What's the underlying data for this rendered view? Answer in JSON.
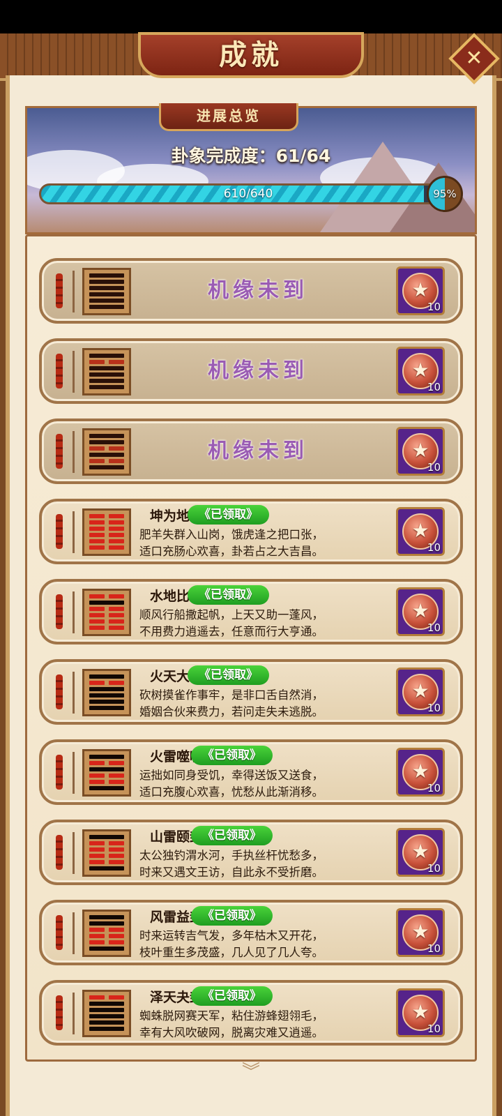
{
  "window": {
    "title": "成就",
    "close_glyph": "✕"
  },
  "overview": {
    "tab_label": "进展总览",
    "completion_text": "卦象完成度：61/64",
    "progress_text": "610/640",
    "progress_fraction": 0.953,
    "percent_text": "95%"
  },
  "locked_text": "机缘未到",
  "claimed_label": "《已领取》",
  "reward_count": "10",
  "items": [
    {
      "state": "locked",
      "lines": [
        1,
        1,
        1,
        1,
        1,
        1
      ]
    },
    {
      "state": "locked",
      "lines": [
        1,
        0,
        1,
        1,
        1,
        1
      ]
    },
    {
      "state": "locked",
      "lines": [
        1,
        1,
        0,
        1,
        0,
        1
      ]
    },
    {
      "state": "claimed",
      "name": "坤为地卦",
      "desc1": "肥羊失群入山岗，饿虎逢之把口张，",
      "desc2": "适口充肠心欢喜，卦若占之大吉昌。",
      "lines": [
        0,
        0,
        0,
        0,
        0,
        0
      ]
    },
    {
      "state": "claimed",
      "name": "水地比卦",
      "desc1": "顺风行船撒起帆，上天又助一蓬风，",
      "desc2": "不用费力逍遥去，任意而行大亨通。",
      "lines": [
        0,
        1,
        0,
        0,
        0,
        0
      ]
    },
    {
      "state": "claimed",
      "name": "火天大有卦",
      "desc1": "砍树摸雀作事牢，是非口舌自然消，",
      "desc2": "婚姻合伙来费力，若问走失未逃脱。",
      "lines": [
        1,
        0,
        1,
        1,
        1,
        1
      ]
    },
    {
      "state": "claimed",
      "name": "火雷噬嗑卦",
      "desc1": "运拙如同身受饥，幸得送饭又送食，",
      "desc2": "适口充腹心欢喜，忧愁从此渐消移。",
      "lines": [
        1,
        0,
        1,
        0,
        0,
        1
      ]
    },
    {
      "state": "claimed",
      "name": "山雷颐卦",
      "desc1": "太公独钓渭水河，手执丝杆忧愁多，",
      "desc2": "时来又遇文王访，自此永不受折磨。",
      "lines": [
        1,
        0,
        0,
        0,
        0,
        1
      ]
    },
    {
      "state": "claimed",
      "name": "风雷益卦",
      "desc1": "时来运转吉气发，多年枯木又开花，",
      "desc2": "枝叶重生多茂盛，几人见了几人夸。",
      "lines": [
        1,
        1,
        0,
        0,
        0,
        1
      ]
    },
    {
      "state": "claimed",
      "name": "泽天夬卦",
      "desc1": "蜘蛛脱网赛天军，粘住游蜂翅翎毛，",
      "desc2": "幸有大风吹破网，脱离灾难又逍遥。",
      "lines": [
        0,
        1,
        1,
        1,
        1,
        1
      ]
    }
  ],
  "scroll_hint_glyph": "︾",
  "colors": {
    "yang_locked": "#2a1008",
    "yin_red": "#d8251a",
    "yang_black": "#120804"
  }
}
